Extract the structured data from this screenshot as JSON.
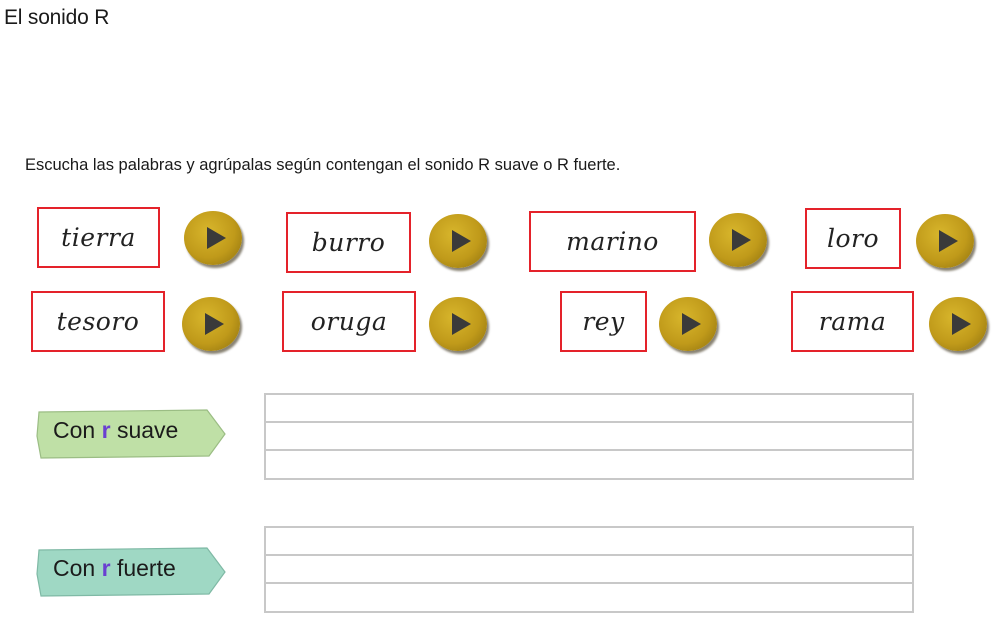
{
  "page": {
    "title": "El sonido R",
    "instruction": "Escucha las palabras y agrúpalas según contengan el sonido R suave o R fuerte."
  },
  "words": [
    {
      "text": "tierra"
    },
    {
      "text": "burro"
    },
    {
      "text": "marino"
    },
    {
      "text": "loro"
    },
    {
      "text": "tesoro"
    },
    {
      "text": "oruga"
    },
    {
      "text": "rey"
    },
    {
      "text": "rama"
    }
  ],
  "play_icon": "play-icon",
  "groups": {
    "suave": {
      "prefix": "Con",
      "letter": "r",
      "suffix": "suave",
      "color": "#bfe0a6"
    },
    "fuerte": {
      "prefix": "Con",
      "letter": "r",
      "suffix": "fuerte",
      "color": "#9fd8c4"
    }
  },
  "colors": {
    "card_border": "#e4222a",
    "play_button": "#c09a1a",
    "highlight_letter": "#6a3fd1",
    "answer_lines": "#c8c8c8"
  }
}
